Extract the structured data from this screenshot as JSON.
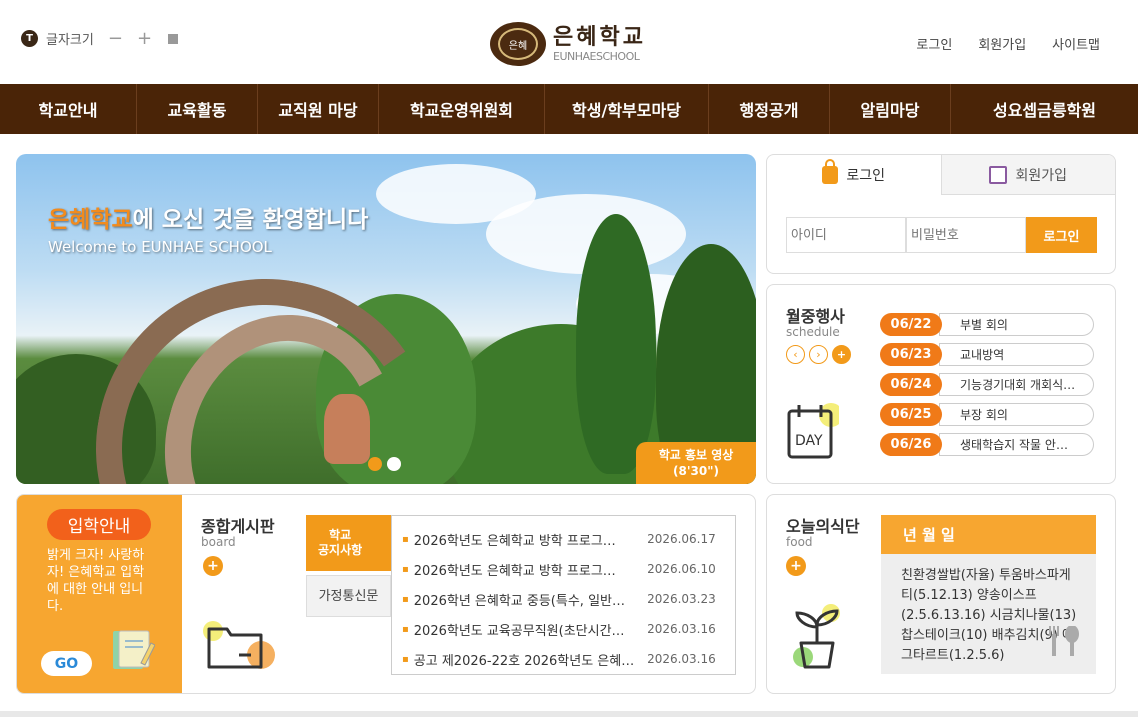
{
  "header": {
    "fontsize_badge": "T",
    "fontsize_label": "글자크기",
    "fontsize_minus": "−",
    "fontsize_plus": "+",
    "logo_mark": "은혜",
    "logo_ko": "은혜학교",
    "logo_en": "EUNHAESCHOOL",
    "util": [
      "로그인",
      "회원가입",
      "사이트맵"
    ]
  },
  "gnb": [
    "학교안내",
    "교육활동",
    "교직원 마당",
    "학교운영위원회",
    "학생/학부모마당",
    "행정공개",
    "알림마당",
    "성요셉금릉학원"
  ],
  "hero": {
    "title_accent": "은혜학교",
    "title_rest": "에 오신 것을 환영합니다",
    "subtitle": "Welcome to EUNHAE SCHOOL",
    "promo_line1": "학교 홍보 영상",
    "promo_line2": "(8'30\")"
  },
  "login": {
    "tab_login": "로그인",
    "tab_join": "회원가입",
    "id_placeholder": "아이디",
    "pw_placeholder": "비밀번호",
    "submit": "로그인"
  },
  "schedule": {
    "title": "월중행사",
    "subtitle": "schedule",
    "prev": "‹",
    "next": "›",
    "more": "+",
    "day_label": "DAY",
    "events": [
      {
        "date": "06/22",
        "text": "부별 회의"
      },
      {
        "date": "06/23",
        "text": "교내방역"
      },
      {
        "date": "06/24",
        "text": "기능경기대회 개회식…"
      },
      {
        "date": "06/25",
        "text": "부장 회의"
      },
      {
        "date": "06/26",
        "text": "생태학습지 작물 안…"
      }
    ]
  },
  "admission": {
    "title": "입학안내",
    "desc": "밝게 크자! 사랑하자! 은혜학교 입학에 대한 안내 입니다.",
    "go": "GO"
  },
  "board": {
    "title": "종합게시판",
    "subtitle": "board",
    "more": "+",
    "tab_notice": "학교\n공지사항",
    "tab_family": "가정통신문",
    "posts": [
      {
        "title": "2026학년도 은혜학교 방학 프로그…",
        "date": "2026.06.17"
      },
      {
        "title": "2026학년도 은혜학교 방학 프로그…",
        "date": "2026.06.10"
      },
      {
        "title": "2026학년 은혜학교 중등(특수, 일반…",
        "date": "2026.03.23"
      },
      {
        "title": "2026학년도 교육공무직원(초단시간…",
        "date": "2026.03.16"
      },
      {
        "title": "공고 제2026-22호 2026학년도 은혜…",
        "date": "2026.03.16"
      }
    ]
  },
  "meal": {
    "title": "오늘의식단",
    "subtitle": "food",
    "more": "+",
    "header": "년 월 일",
    "menu": "친환경쌀밥(자율) 투움바스파게티(5.12.13) 양송이스프(2.5.6.13.16) 시금치나물(13) 찹스테이크(10) 배추김치(9) 에그타르트(1.2.5.6)"
  },
  "colors": {
    "brand_brown": "#4a2407",
    "accent_orange": "#f29a1a",
    "date_orange": "#f07a18"
  }
}
